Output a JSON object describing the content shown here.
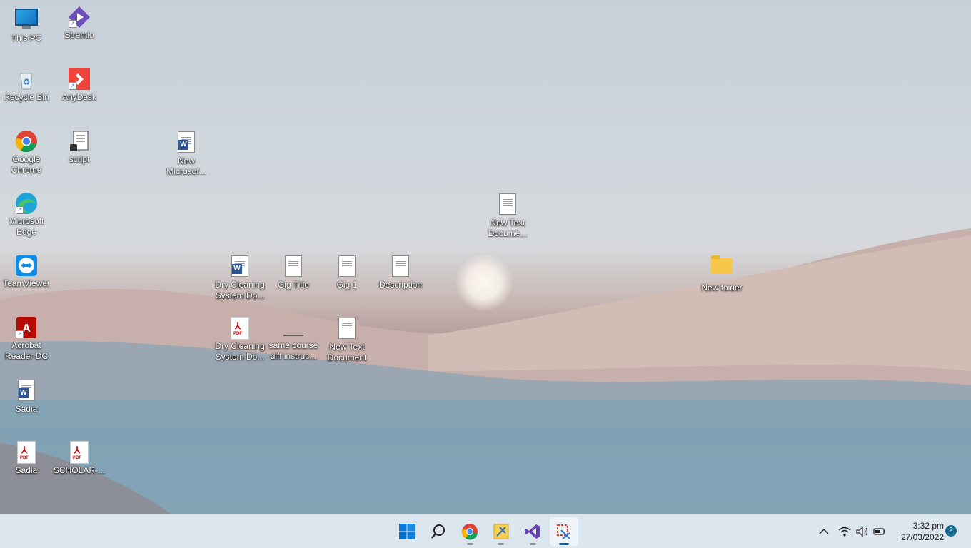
{
  "desktop": {
    "icons": [
      {
        "label": "This PC"
      },
      {
        "label": "Stremio"
      },
      {
        "label": "Recycle Bin"
      },
      {
        "label": "AnyDesk"
      },
      {
        "label": "Google\nChrome"
      },
      {
        "label": "script"
      },
      {
        "label": "New\nMicrosof..."
      },
      {
        "label": "Microsoft\nEdge"
      },
      {
        "label": "New Text\nDocume..."
      },
      {
        "label": "TeamViewer"
      },
      {
        "label": "Dry Cleaning\nSystem Do..."
      },
      {
        "label": "Gig Title"
      },
      {
        "label": "Gig 1"
      },
      {
        "label": "Description"
      },
      {
        "label": "New folder"
      },
      {
        "label": "Acrobat\nReader DC"
      },
      {
        "label": "Dry Cleaning\nSystem Do..."
      },
      {
        "label": "same course\ndiff instruc..."
      },
      {
        "label": "New Text\nDocument"
      },
      {
        "label": "Sadia"
      },
      {
        "label": "Sadia"
      },
      {
        "label": "SCHOLAR-..."
      }
    ]
  },
  "taskbar": {
    "apps": [
      "start-icon",
      "search-icon",
      "chrome-icon",
      "snip-tools-icon",
      "visual-studio-icon",
      "snipping-tool-icon"
    ],
    "tray": {
      "chevron": "^",
      "time": "3:32 pm",
      "date": "27/03/2022",
      "notifications": "2"
    }
  }
}
